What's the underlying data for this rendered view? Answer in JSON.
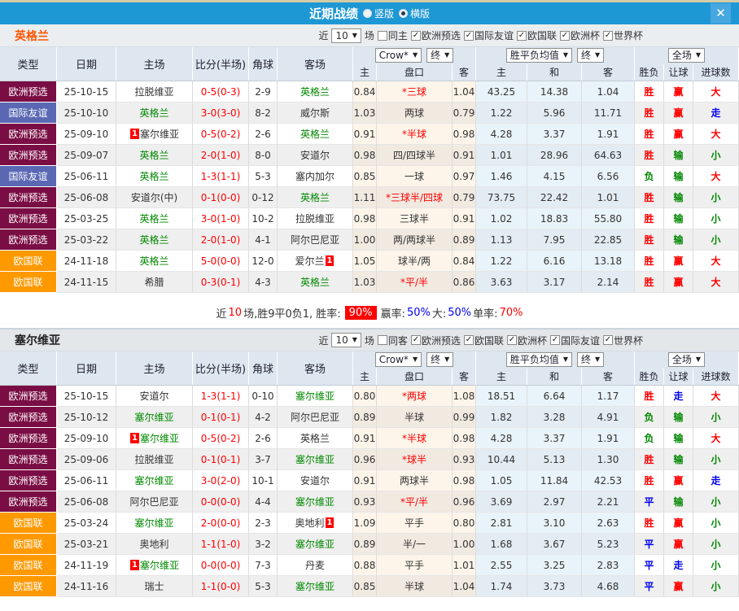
{
  "header": {
    "title": "近期战绩",
    "radio_vertical": "竖版",
    "radio_horizontal": "横版",
    "close_icon": "✕"
  },
  "filter_labels": {
    "near": "近",
    "games": "场"
  },
  "table_dropdowns": {
    "odds_source": "Crow*",
    "final_a": "终",
    "wdl_avg": "胜平负均值",
    "final_b": "终",
    "full_match": "全场"
  },
  "columns": {
    "type": "类型",
    "date": "日期",
    "home": "主场",
    "score": "比分(半场)",
    "corner": "角球",
    "away": "客场",
    "h": "主",
    "handicap": "盘口",
    "a": "客",
    "avg_home": "主",
    "avg_draw": "和",
    "avg_away": "客",
    "result": "胜负",
    "handicap_result": "让球",
    "goals": "进球数"
  },
  "league_colors": {
    "欧洲预选": "#7a0e44",
    "国际友谊": "#5a68b4",
    "欧国联": "#ff9900"
  },
  "result_colors": {
    "red": "#ff0000",
    "green": "#008800",
    "blue": "#0000ee",
    "black": "#333333",
    "white": "#ffffff"
  },
  "badge_label": "1",
  "sections": [
    {
      "team": "英格兰",
      "team_color": "#ff5500",
      "filter": {
        "count": "10",
        "same_label": "同主",
        "same_checked": false,
        "leagues": [
          "欧洲预选",
          "国际友谊",
          "欧国联",
          "欧洲杯",
          "世界杯"
        ]
      },
      "rows": [
        {
          "league": "欧洲预选",
          "date": "25-10-15",
          "home": {
            "name": "拉脱维亚",
            "focal": false,
            "badge": null
          },
          "score": "0-5(0-3)",
          "corner": "2-9",
          "away": {
            "name": "英格兰",
            "focal": true,
            "badge": null
          },
          "h": "0.84",
          "hcap": "*三球",
          "a": "1.04",
          "avg_h": "43.25",
          "avg_d": "14.38",
          "avg_a": "1.04",
          "res": {
            "t": "胜",
            "c": "red"
          },
          "let": {
            "t": "赢",
            "c": "red"
          },
          "goal": {
            "t": "大",
            "c": "red"
          }
        },
        {
          "league": "国际友谊",
          "date": "25-10-10",
          "home": {
            "name": "英格兰",
            "focal": true,
            "badge": null
          },
          "score": "3-0(3-0)",
          "corner": "8-2",
          "away": {
            "name": "威尔斯",
            "focal": false,
            "badge": null
          },
          "h": "1.03",
          "hcap": "两球",
          "a": "0.79",
          "avg_h": "1.22",
          "avg_d": "5.96",
          "avg_a": "11.71",
          "res": {
            "t": "胜",
            "c": "red"
          },
          "let": {
            "t": "赢",
            "c": "red"
          },
          "goal": {
            "t": "走",
            "c": "blue"
          }
        },
        {
          "league": "欧洲预选",
          "date": "25-09-10",
          "home": {
            "name": "塞尔维亚",
            "focal": false,
            "badge": "before"
          },
          "score": "0-5(0-2)",
          "corner": "2-6",
          "away": {
            "name": "英格兰",
            "focal": true,
            "badge": null
          },
          "h": "0.91",
          "hcap": "*半球",
          "a": "0.98",
          "avg_h": "4.28",
          "avg_d": "3.37",
          "avg_a": "1.91",
          "res": {
            "t": "胜",
            "c": "red"
          },
          "let": {
            "t": "赢",
            "c": "red"
          },
          "goal": {
            "t": "大",
            "c": "red"
          }
        },
        {
          "league": "欧洲预选",
          "date": "25-09-07",
          "home": {
            "name": "英格兰",
            "focal": true,
            "badge": null
          },
          "score": "2-0(1-0)",
          "corner": "8-0",
          "away": {
            "name": "安道尔",
            "focal": false,
            "badge": null
          },
          "h": "0.98",
          "hcap": "四/四球半",
          "a": "0.91",
          "avg_h": "1.01",
          "avg_d": "28.96",
          "avg_a": "64.63",
          "res": {
            "t": "胜",
            "c": "red"
          },
          "let": {
            "t": "输",
            "c": "green"
          },
          "goal": {
            "t": "小",
            "c": "green"
          }
        },
        {
          "league": "国际友谊",
          "date": "25-06-11",
          "home": {
            "name": "英格兰",
            "focal": true,
            "badge": null
          },
          "score": "1-3(1-1)",
          "corner": "5-3",
          "away": {
            "name": "塞内加尔",
            "focal": false,
            "badge": null
          },
          "h": "0.85",
          "hcap": "一球",
          "a": "0.97",
          "avg_h": "1.46",
          "avg_d": "4.15",
          "avg_a": "6.56",
          "res": {
            "t": "负",
            "c": "green"
          },
          "let": {
            "t": "输",
            "c": "green"
          },
          "goal": {
            "t": "大",
            "c": "red"
          }
        },
        {
          "league": "欧洲预选",
          "date": "25-06-08",
          "home": {
            "name": "安道尔(中)",
            "focal": false,
            "badge": null
          },
          "score": "0-1(0-0)",
          "corner": "0-12",
          "away": {
            "name": "英格兰",
            "focal": true,
            "badge": null
          },
          "h": "1.11",
          "hcap": "*三球半/四球",
          "a": "0.79",
          "avg_h": "73.75",
          "avg_d": "22.42",
          "avg_a": "1.01",
          "res": {
            "t": "胜",
            "c": "red"
          },
          "let": {
            "t": "输",
            "c": "green"
          },
          "goal": {
            "t": "小",
            "c": "green"
          }
        },
        {
          "league": "欧洲预选",
          "date": "25-03-25",
          "home": {
            "name": "英格兰",
            "focal": true,
            "badge": null
          },
          "score": "3-0(1-0)",
          "corner": "10-2",
          "away": {
            "name": "拉脱维亚",
            "focal": false,
            "badge": null
          },
          "h": "0.98",
          "hcap": "三球半",
          "a": "0.91",
          "avg_h": "1.02",
          "avg_d": "18.83",
          "avg_a": "55.80",
          "res": {
            "t": "胜",
            "c": "red"
          },
          "let": {
            "t": "输",
            "c": "green"
          },
          "goal": {
            "t": "小",
            "c": "green"
          }
        },
        {
          "league": "欧洲预选",
          "date": "25-03-22",
          "home": {
            "name": "英格兰",
            "focal": true,
            "badge": null
          },
          "score": "2-0(1-0)",
          "corner": "4-1",
          "away": {
            "name": "阿尔巴尼亚",
            "focal": false,
            "badge": null
          },
          "h": "1.00",
          "hcap": "两/两球半",
          "a": "0.89",
          "avg_h": "1.13",
          "avg_d": "7.95",
          "avg_a": "22.85",
          "res": {
            "t": "胜",
            "c": "red"
          },
          "let": {
            "t": "输",
            "c": "green"
          },
          "goal": {
            "t": "小",
            "c": "green"
          }
        },
        {
          "league": "欧国联",
          "date": "24-11-18",
          "home": {
            "name": "英格兰",
            "focal": true,
            "badge": null
          },
          "score": "5-0(0-0)",
          "corner": "12-0",
          "away": {
            "name": "爱尔兰",
            "focal": false,
            "badge": "after"
          },
          "h": "1.05",
          "hcap": "球半/两",
          "a": "0.84",
          "avg_h": "1.22",
          "avg_d": "6.16",
          "avg_a": "13.18",
          "res": {
            "t": "胜",
            "c": "red"
          },
          "let": {
            "t": "赢",
            "c": "red"
          },
          "goal": {
            "t": "大",
            "c": "red"
          }
        },
        {
          "league": "欧国联",
          "date": "24-11-15",
          "home": {
            "name": "希腊",
            "focal": false,
            "badge": null
          },
          "score": "0-3(0-1)",
          "corner": "4-3",
          "away": {
            "name": "英格兰",
            "focal": true,
            "badge": null
          },
          "h": "1.03",
          "hcap": "*平/半",
          "a": "0.86",
          "avg_h": "3.63",
          "avg_d": "3.17",
          "avg_a": "2.14",
          "res": {
            "t": "胜",
            "c": "red"
          },
          "let": {
            "t": "赢",
            "c": "red"
          },
          "goal": {
            "t": "大",
            "c": "red"
          }
        }
      ],
      "summary_parts": [
        {
          "t": "近",
          "c": "black"
        },
        {
          "t": "10",
          "c": "red"
        },
        {
          "t": "场,胜9平0负1, 胜率:",
          "c": "black"
        },
        {
          "t": "90%",
          "c": "white",
          "bg": "red"
        },
        {
          "t": "赢率:",
          "c": "black"
        },
        {
          "t": "50%",
          "c": "blue"
        },
        {
          "t": " 大:",
          "c": "black"
        },
        {
          "t": "50%",
          "c": "blue"
        },
        {
          "t": " 单率:",
          "c": "black"
        },
        {
          "t": "70%",
          "c": "red"
        }
      ]
    },
    {
      "team": "塞尔维亚",
      "team_color": "#222222",
      "filter": {
        "count": "10",
        "same_label": "同客",
        "same_checked": false,
        "leagues": [
          "欧洲预选",
          "欧国联",
          "欧洲杯",
          "国际友谊",
          "世界杯"
        ]
      },
      "rows": [
        {
          "league": "欧洲预选",
          "date": "25-10-15",
          "home": {
            "name": "安道尔",
            "focal": false,
            "badge": null
          },
          "score": "1-3(1-1)",
          "corner": "0-10",
          "away": {
            "name": "塞尔维亚",
            "focal": true,
            "badge": null
          },
          "h": "0.80",
          "hcap": "*两球",
          "a": "1.08",
          "avg_h": "18.51",
          "avg_d": "6.64",
          "avg_a": "1.17",
          "res": {
            "t": "胜",
            "c": "red"
          },
          "let": {
            "t": "走",
            "c": "blue"
          },
          "goal": {
            "t": "大",
            "c": "red"
          }
        },
        {
          "league": "欧洲预选",
          "date": "25-10-12",
          "home": {
            "name": "塞尔维亚",
            "focal": true,
            "badge": null
          },
          "score": "0-1(0-1)",
          "corner": "4-2",
          "away": {
            "name": "阿尔巴尼亚",
            "focal": false,
            "badge": null
          },
          "h": "0.89",
          "hcap": "半球",
          "a": "0.99",
          "avg_h": "1.82",
          "avg_d": "3.28",
          "avg_a": "4.91",
          "res": {
            "t": "负",
            "c": "green"
          },
          "let": {
            "t": "输",
            "c": "green"
          },
          "goal": {
            "t": "小",
            "c": "green"
          }
        },
        {
          "league": "欧洲预选",
          "date": "25-09-10",
          "home": {
            "name": "塞尔维亚",
            "focal": true,
            "badge": "before"
          },
          "score": "0-5(0-2)",
          "corner": "2-6",
          "away": {
            "name": "英格兰",
            "focal": false,
            "badge": null
          },
          "h": "0.91",
          "hcap": "*半球",
          "a": "0.98",
          "avg_h": "4.28",
          "avg_d": "3.37",
          "avg_a": "1.91",
          "res": {
            "t": "负",
            "c": "green"
          },
          "let": {
            "t": "输",
            "c": "green"
          },
          "goal": {
            "t": "大",
            "c": "red"
          }
        },
        {
          "league": "欧洲预选",
          "date": "25-09-06",
          "home": {
            "name": "拉脱维亚",
            "focal": false,
            "badge": null
          },
          "score": "0-1(0-1)",
          "corner": "3-7",
          "away": {
            "name": "塞尔维亚",
            "focal": true,
            "badge": null
          },
          "h": "0.96",
          "hcap": "*球半",
          "a": "0.93",
          "avg_h": "10.44",
          "avg_d": "5.13",
          "avg_a": "1.30",
          "res": {
            "t": "胜",
            "c": "red"
          },
          "let": {
            "t": "输",
            "c": "green"
          },
          "goal": {
            "t": "小",
            "c": "green"
          }
        },
        {
          "league": "欧洲预选",
          "date": "25-06-11",
          "home": {
            "name": "塞尔维亚",
            "focal": true,
            "badge": null
          },
          "score": "3-0(2-0)",
          "corner": "10-1",
          "away": {
            "name": "安道尔",
            "focal": false,
            "badge": null
          },
          "h": "0.91",
          "hcap": "两球半",
          "a": "0.98",
          "avg_h": "1.05",
          "avg_d": "11.84",
          "avg_a": "42.53",
          "res": {
            "t": "胜",
            "c": "red"
          },
          "let": {
            "t": "赢",
            "c": "red"
          },
          "goal": {
            "t": "走",
            "c": "blue"
          }
        },
        {
          "league": "欧洲预选",
          "date": "25-06-08",
          "home": {
            "name": "阿尔巴尼亚",
            "focal": false,
            "badge": null
          },
          "score": "0-0(0-0)",
          "corner": "4-4",
          "away": {
            "name": "塞尔维亚",
            "focal": true,
            "badge": null
          },
          "h": "0.93",
          "hcap": "*平/半",
          "a": "0.96",
          "avg_h": "3.69",
          "avg_d": "2.97",
          "avg_a": "2.21",
          "res": {
            "t": "平",
            "c": "blue"
          },
          "let": {
            "t": "输",
            "c": "green"
          },
          "goal": {
            "t": "小",
            "c": "green"
          }
        },
        {
          "league": "欧国联",
          "date": "25-03-24",
          "home": {
            "name": "塞尔维亚",
            "focal": true,
            "badge": null
          },
          "score": "2-0(0-0)",
          "corner": "2-3",
          "away": {
            "name": "奥地利",
            "focal": false,
            "badge": "after"
          },
          "h": "1.09",
          "hcap": "平手",
          "a": "0.80",
          "avg_h": "2.81",
          "avg_d": "3.10",
          "avg_a": "2.63",
          "res": {
            "t": "胜",
            "c": "red"
          },
          "let": {
            "t": "赢",
            "c": "red"
          },
          "goal": {
            "t": "小",
            "c": "green"
          }
        },
        {
          "league": "欧国联",
          "date": "25-03-21",
          "home": {
            "name": "奥地利",
            "focal": false,
            "badge": null
          },
          "score": "1-1(1-0)",
          "corner": "3-2",
          "away": {
            "name": "塞尔维亚",
            "focal": true,
            "badge": null
          },
          "h": "0.89",
          "hcap": "半/一",
          "a": "1.00",
          "avg_h": "1.68",
          "avg_d": "3.67",
          "avg_a": "5.23",
          "res": {
            "t": "平",
            "c": "blue"
          },
          "let": {
            "t": "赢",
            "c": "red"
          },
          "goal": {
            "t": "小",
            "c": "green"
          }
        },
        {
          "league": "欧国联",
          "date": "24-11-19",
          "home": {
            "name": "塞尔维亚",
            "focal": true,
            "badge": "before"
          },
          "score": "0-0(0-0)",
          "corner": "7-3",
          "away": {
            "name": "丹麦",
            "focal": false,
            "badge": null
          },
          "h": "0.88",
          "hcap": "平手",
          "a": "1.01",
          "avg_h": "2.55",
          "avg_d": "3.25",
          "avg_a": "2.83",
          "res": {
            "t": "平",
            "c": "blue"
          },
          "let": {
            "t": "走",
            "c": "blue"
          },
          "goal": {
            "t": "小",
            "c": "green"
          }
        },
        {
          "league": "欧国联",
          "date": "24-11-16",
          "home": {
            "name": "瑞士",
            "focal": false,
            "badge": null
          },
          "score": "1-1(0-0)",
          "corner": "5-3",
          "away": {
            "name": "塞尔维亚",
            "focal": true,
            "badge": null
          },
          "h": "0.85",
          "hcap": "半球",
          "a": "1.04",
          "avg_h": "1.74",
          "avg_d": "3.73",
          "avg_a": "4.68",
          "res": {
            "t": "平",
            "c": "blue"
          },
          "let": {
            "t": "赢",
            "c": "red"
          },
          "goal": {
            "t": "小",
            "c": "green"
          }
        }
      ]
    }
  ]
}
